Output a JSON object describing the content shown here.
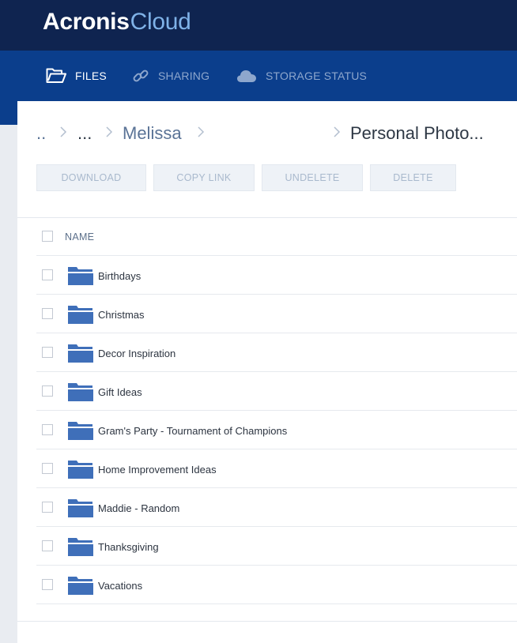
{
  "app": {
    "brand": "Acronis",
    "product": "Cloud"
  },
  "nav": {
    "files": "FILES",
    "sharing": "SHARING",
    "storage": "STORAGE STATUS",
    "active": "files"
  },
  "breadcrumb": {
    "root": "..",
    "ellipsis": "...",
    "parent": "Melissa",
    "current": "Personal Photo..."
  },
  "toolbar": {
    "download": "DOWNLOAD",
    "copy_link": "COPY LINK",
    "undelete": "UNDELETE",
    "delete": "DELETE"
  },
  "table": {
    "name_header": "NAME",
    "items": [
      {
        "name": "Birthdays",
        "type": "folder-icon"
      },
      {
        "name": "Christmas",
        "type": "folder-icon"
      },
      {
        "name": "Decor Inspiration",
        "type": "folder-icon"
      },
      {
        "name": "Gift Ideas",
        "type": "folder-icon"
      },
      {
        "name": "Gram's Party - Tournament of Champions",
        "type": "folder-icon"
      },
      {
        "name": "Home Improvement Ideas",
        "type": "folder-icon"
      },
      {
        "name": "Maddie - Random",
        "type": "folder-icon"
      },
      {
        "name": "Thanksgiving",
        "type": "folder-icon"
      },
      {
        "name": "Vacations",
        "type": "folder-icon"
      }
    ]
  },
  "colors": {
    "header_bg": "#0f2450",
    "nav_bg": "#0b3e8c",
    "folder": "#3f6fb9",
    "link": "#5a7396"
  }
}
